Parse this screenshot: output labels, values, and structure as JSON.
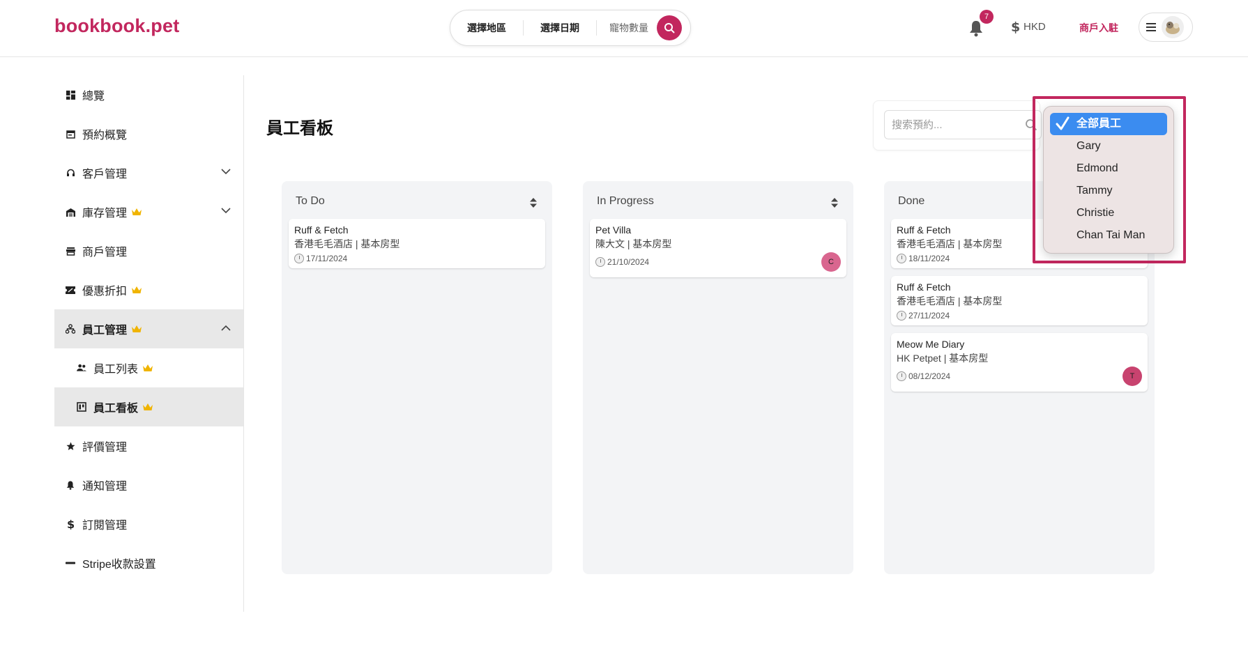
{
  "header": {
    "logo": "bookbook.pet",
    "search": {
      "region": "選擇地區",
      "date": "選擇日期",
      "pets": "寵物數量"
    },
    "notifications_count": "7",
    "currency": "HKD",
    "merchant_link": "商戶入駐"
  },
  "sidebar": {
    "items": [
      {
        "label": "總覽",
        "icon": "dashboard-icon"
      },
      {
        "label": "預約概覽",
        "icon": "calendar-icon"
      },
      {
        "label": "客戶管理",
        "icon": "headset-icon",
        "expandable": true
      },
      {
        "label": "庫存管理",
        "icon": "warehouse-icon",
        "premium": true,
        "expandable": true
      },
      {
        "label": "商戶管理",
        "icon": "store-icon"
      },
      {
        "label": "優惠折扣",
        "icon": "ticket-icon",
        "premium": true
      },
      {
        "label": "員工管理",
        "icon": "org-chart-icon",
        "premium": true,
        "expanded": true
      },
      {
        "label": "員工列表",
        "icon": "people-icon",
        "premium": true,
        "sub": true
      },
      {
        "label": "員工看板",
        "icon": "kanban-icon",
        "premium": true,
        "sub": true,
        "active": true
      },
      {
        "label": "評價管理",
        "icon": "star-icon"
      },
      {
        "label": "通知管理",
        "icon": "bell-icon"
      },
      {
        "label": "訂閱管理",
        "icon": "dollar-icon"
      },
      {
        "label": "Stripe收款設置",
        "icon": "stripe-icon"
      }
    ]
  },
  "main": {
    "title": "員工看板",
    "search_placeholder": "搜索預約...",
    "columns": [
      {
        "title": "To Do",
        "cards": [
          {
            "shop": "Ruff & Fetch",
            "room": "香港毛毛酒店 | 基本房型",
            "date": "17/11/2024",
            "assignee": ""
          }
        ]
      },
      {
        "title": "In Progress",
        "cards": [
          {
            "shop": "Pet Villa",
            "room": "陳大文 | 基本房型",
            "date": "21/10/2024",
            "assignee": "C"
          }
        ]
      },
      {
        "title": "Done",
        "cards": [
          {
            "shop": "Ruff & Fetch",
            "room": "香港毛毛酒店 | 基本房型",
            "date": "18/11/2024",
            "assignee": ""
          },
          {
            "shop": "Ruff & Fetch",
            "room": "香港毛毛酒店 | 基本房型",
            "date": "27/11/2024",
            "assignee": ""
          },
          {
            "shop": "Meow Me Diary",
            "room": "HK Petpet | 基本房型",
            "date": "08/12/2024",
            "assignee": "T"
          }
        ]
      }
    ]
  },
  "staff_dropdown": {
    "selected": "全部員工",
    "options": [
      "全部員工",
      "Gary",
      "Edmond",
      "Tammy",
      "Christie",
      "Chan Tai Man"
    ]
  },
  "colors": {
    "brand": "#c2275e",
    "selected_option": "#3b8cf0",
    "assignee_c": "#d9668f",
    "assignee_t": "#c8436f"
  }
}
